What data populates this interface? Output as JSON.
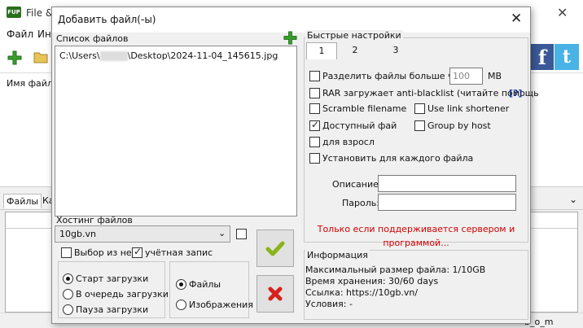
{
  "main_window": {
    "title": "File &",
    "logo": "FUP",
    "close_glyph": "✕",
    "menu": [
      "Файл",
      "Ин"
    ],
    "file_name_header": "Имя файла",
    "tabs": [
      "Файлы",
      "Ка"
    ],
    "status_text": "b_o_m",
    "social": {
      "facebook": "f",
      "twitter": "t"
    },
    "icons": {
      "add": "plus-icon",
      "folder": "folder-icon",
      "chevron": "double-chevron-down-icon"
    }
  },
  "dialog": {
    "title": "Добавить файл(-ы)",
    "close_glyph": "✕",
    "file_list": {
      "label": "Список файлов",
      "path_prefix": "C:\\Users\\",
      "path_suffix": "\\Desktop\\2024-11-04_145615.jpg"
    },
    "hosting": {
      "label": "Хостинг файлов",
      "selected": "10gb.vn",
      "extra_checkbox_checked": false
    },
    "options": {
      "choose_from_them": {
        "label": "Выбор из нес",
        "checked": false
      },
      "account": {
        "label": "учётная запис",
        "checked": true
      }
    },
    "upload_mode": {
      "options": [
        "Старт загрузки",
        "В очередь загрузки",
        "Пауза загрузки"
      ],
      "selected": 0
    },
    "upload_type": {
      "options": [
        "Файлы",
        "Изображения"
      ],
      "selected": 0
    },
    "buttons": {
      "ok": "check-icon",
      "cancel": "red-x-icon"
    },
    "quick_settings": {
      "label": "Быстрые настройки",
      "tabs": [
        "1",
        "2",
        "3"
      ],
      "active_tab": 0,
      "split": {
        "label": "Разделить файлы больше че",
        "value": "100",
        "unit": "MB",
        "checked": false
      },
      "rar": {
        "label": "RAR загружает anti-blacklist (читайте помощь",
        "help": "[?]",
        "checked": false
      },
      "scramble": {
        "label": "Scramble filename",
        "checked": false
      },
      "link_shortener": {
        "label": "Use link shortener",
        "checked": false
      },
      "available": {
        "label": "Доступный фай",
        "checked": true
      },
      "group_by_host": {
        "label": "Group by host",
        "checked": false
      },
      "adult": {
        "label": "для взросл",
        "checked": false
      },
      "per_file": {
        "label": "Установить для каждого файла",
        "checked": false
      },
      "description_label": "Описание:",
      "description_value": "",
      "password_label": "Пароль:",
      "password_value": "",
      "note": "Только если поддерживается сервером и программой...",
      "note_color": "#d40000"
    },
    "info": {
      "label": "Информация",
      "lines": [
        "Максимальный размер файла: 1/10GB",
        "Время хранения: 30/60 days",
        "Ссылка: https://10gb.vn/",
        "Условия: -"
      ]
    }
  }
}
